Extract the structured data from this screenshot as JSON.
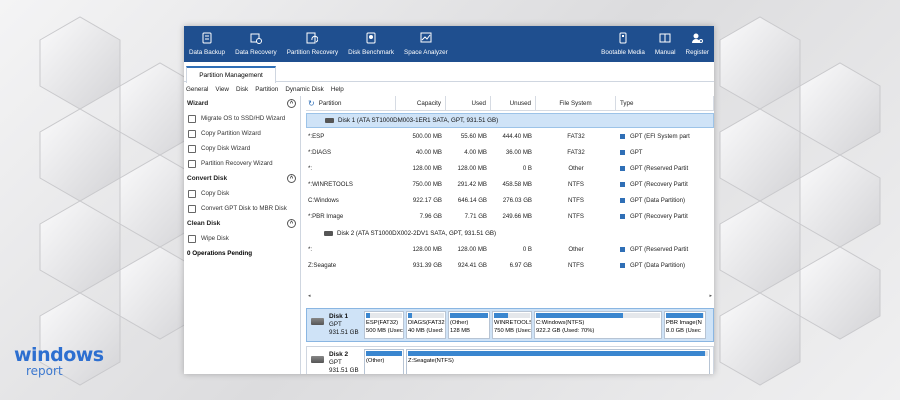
{
  "toolbar": {
    "left": [
      {
        "label": "Data Backup",
        "icon": "data-backup-icon"
      },
      {
        "label": "Data Recovery",
        "icon": "data-recovery-icon"
      },
      {
        "label": "Partition Recovery",
        "icon": "partition-recovery-icon"
      },
      {
        "label": "Disk Benchmark",
        "icon": "disk-benchmark-icon"
      },
      {
        "label": "Space Analyzer",
        "icon": "space-analyzer-icon"
      }
    ],
    "right": [
      {
        "label": "Bootable Media",
        "icon": "bootable-media-icon"
      },
      {
        "label": "Manual",
        "icon": "manual-icon"
      },
      {
        "label": "Register",
        "icon": "register-icon"
      }
    ]
  },
  "tab": {
    "label": "Partition Management"
  },
  "menu": [
    "General",
    "View",
    "Disk",
    "Partition",
    "Dynamic Disk",
    "Help"
  ],
  "sidebar": {
    "sections": [
      {
        "title": "Wizard",
        "toggle": "^",
        "items": [
          "Migrate OS to SSD/HD Wizard",
          "Copy Partition Wizard",
          "Copy Disk Wizard",
          "Partition Recovery Wizard"
        ]
      },
      {
        "title": "Convert Disk",
        "toggle": "^",
        "items": [
          "Copy Disk",
          "Convert GPT Disk to MBR Disk"
        ]
      },
      {
        "title": "Clean Disk",
        "toggle": "^",
        "items": [
          "Wipe Disk"
        ]
      }
    ],
    "pending": "0 Operations Pending"
  },
  "table": {
    "headers": [
      "Partition",
      "Capacity",
      "Used",
      "Unused",
      "File System",
      "Type"
    ],
    "disk1": "Disk 1 (ATA ST1000DM003-1ER1 SATA, GPT, 931.51 GB)",
    "disk1_rows": [
      [
        "*:ESP",
        "500.00 MB",
        "55.60 MB",
        "444.40 MB",
        "FAT32",
        "GPT (EFI System part"
      ],
      [
        "*:DIAGS",
        "40.00 MB",
        "4.00 MB",
        "36.00 MB",
        "FAT32",
        "GPT"
      ],
      [
        "*:",
        "128.00 MB",
        "128.00 MB",
        "0 B",
        "Other",
        "GPT (Reserved Partit"
      ],
      [
        "*:WINRETOOLS",
        "750.00 MB",
        "291.42 MB",
        "458.58 MB",
        "NTFS",
        "GPT (Recovery Partit"
      ],
      [
        "C:Windows",
        "922.17 GB",
        "646.14 GB",
        "276.03 GB",
        "NTFS",
        "GPT (Data Partition)"
      ],
      [
        "*:PBR Image",
        "7.96 GB",
        "7.71 GB",
        "249.66 MB",
        "NTFS",
        "GPT (Recovery Partit"
      ]
    ],
    "disk2": "Disk 2 (ATA ST1000DX002-2DV1 SATA, GPT, 931.51 GB)",
    "disk2_rows": [
      [
        "*:",
        "128.00 MB",
        "128.00 MB",
        "0 B",
        "Other",
        "GPT (Reserved Partit"
      ],
      [
        "Z:Seagate",
        "931.39 GB",
        "924.41 GB",
        "6.97 GB",
        "NTFS",
        "GPT (Data Partition)"
      ]
    ]
  },
  "map": {
    "disk1": {
      "name": "Disk 1",
      "style": "GPT",
      "size": "931.51 GB",
      "parts": [
        {
          "l1": "ESP(FAT32)",
          "l2": "500 MB (Usec",
          "used": 0.11
        },
        {
          "l1": "DIAGS(FAT32",
          "l2": "40 MB (Used:",
          "used": 0.1
        },
        {
          "l1": "(Other)",
          "l2": "128 MB",
          "used": 1.0
        },
        {
          "l1": "WINRETOOLS",
          "l2": "750 MB (Usec",
          "used": 0.39
        },
        {
          "l1": "C:Windows(NTFS)",
          "l2": "922.2 GB (Used: 70%)",
          "used": 0.7
        },
        {
          "l1": "PBR Image(N",
          "l2": "8.0 GB (Usec",
          "used": 0.97
        }
      ]
    },
    "disk2": {
      "name": "Disk 2",
      "style": "GPT",
      "size": "931.51 GB",
      "parts": [
        {
          "l1": "(Other)",
          "l2": "",
          "used": 1.0
        },
        {
          "l1": "Z:Seagate(NTFS)",
          "l2": "",
          "used": 0.99
        }
      ]
    }
  },
  "watermark": {
    "top": "windows",
    "bottom": "report"
  },
  "colors": {
    "toolbar": "#1f4f8f",
    "accent": "#3a86cf",
    "selected": "#cfe3f7"
  }
}
